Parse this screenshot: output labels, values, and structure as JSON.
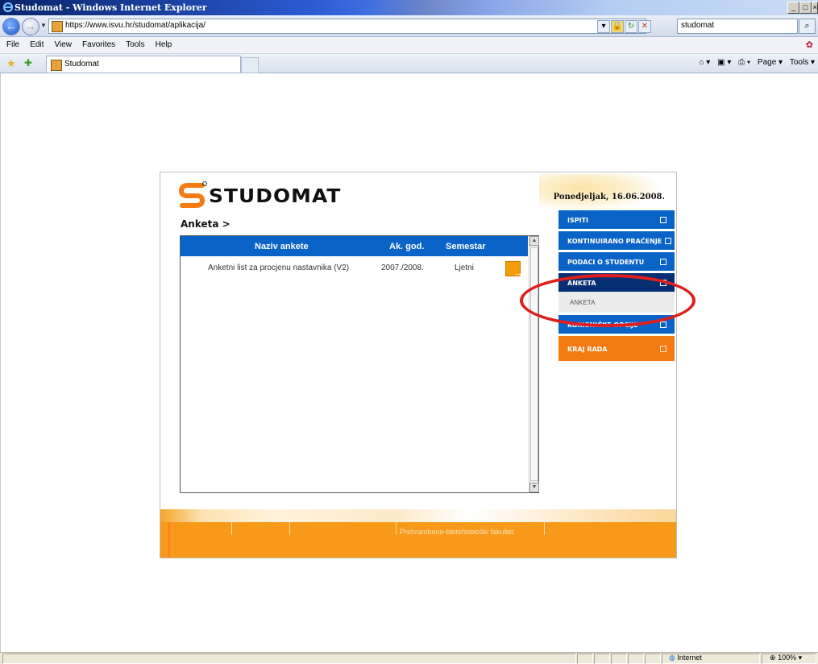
{
  "window": {
    "title": "Studomat - Windows Internet Explorer",
    "min_glyph": "_",
    "max_glyph": "□",
    "close_glyph": "×"
  },
  "address": {
    "url": "https://www.isvu.hr/studomat/aplikacija/",
    "search_value": "studomat",
    "search_glyph": "⌕"
  },
  "menu": [
    "File",
    "Edit",
    "View",
    "Favorites",
    "Tools",
    "Help"
  ],
  "tab": {
    "label": "Studomat"
  },
  "command_bar": {
    "home": "⌂ ▾",
    "feeds": "▣ ▾",
    "print": "⎙ ▾",
    "page": "Page ▾",
    "tools": "Tools ▾"
  },
  "app": {
    "logo_text": "STUDOMAT",
    "date": "Ponedjeljak, 16.06.2008.",
    "breadcrumb": "Anketa >",
    "table": {
      "headers": [
        "Naziv ankete",
        "Ak. god.",
        "Semestar"
      ],
      "rows": [
        {
          "naziv": "Anketni list za procjenu nastavnika (V2)",
          "god": "2007./2008.",
          "semestar": "Ljetni",
          "action_glyph": "→"
        }
      ]
    },
    "nav": {
      "ispiti": "ISPITI",
      "kontinuirano": "KONTINUIRANO PRAĆENJE",
      "podaci": "PODACI O STUDENTU",
      "anketa": "ANKETA",
      "anketa_sub": "ANKETA",
      "korisnicke": "KORISNIČKE OPCIJE",
      "kraj": "KRAJ RADA"
    },
    "footer": "Prehrambeno-biotehnološki fakultet"
  },
  "statusbar": {
    "zone": "Internet",
    "zoom": "100%"
  },
  "colors": {
    "nav_blue": "#0a63c6",
    "nav_active": "#062f73",
    "orange": "#f79a19",
    "highlight": "#e01e1e"
  }
}
